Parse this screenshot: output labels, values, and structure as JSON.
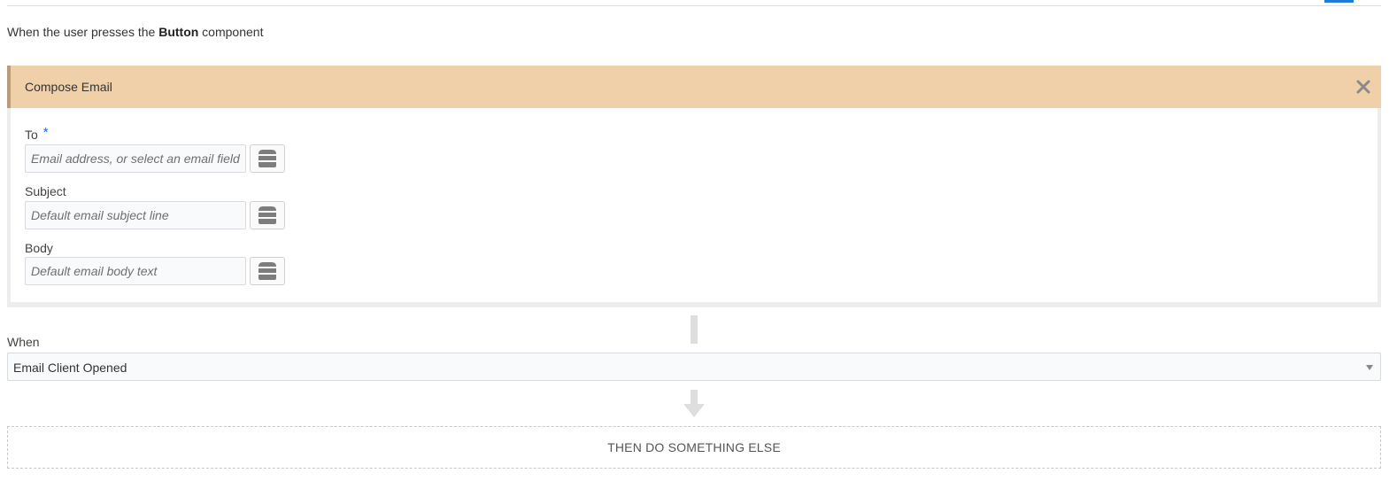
{
  "trigger": {
    "prefix": "When the user presses the ",
    "component": "Button",
    "suffix": " component"
  },
  "action": {
    "title": "Compose Email",
    "close_icon": "close-icon",
    "fields": [
      {
        "label": "To",
        "required": true,
        "required_mark": "*",
        "value": "",
        "placeholder": "Email address, or select an email field",
        "source_icon": "database-icon"
      },
      {
        "label": "Subject",
        "required": false,
        "value": "",
        "placeholder": "Default email subject line",
        "source_icon": "database-icon"
      },
      {
        "label": "Body",
        "required": false,
        "value": "",
        "placeholder": "Default email body text",
        "source_icon": "database-icon"
      }
    ]
  },
  "when": {
    "label": "When",
    "selected": "Email Client Opened",
    "caret_icon": "chevron-down-icon"
  },
  "next": {
    "label": "THEN DO SOMETHING ELSE",
    "arrow_icon": "arrow-down-icon"
  },
  "colors": {
    "header_bg": "#f0d0a9",
    "header_border": "#b89d7a",
    "required_star": "#1f6fd0",
    "accent": "#1f7ad8"
  }
}
